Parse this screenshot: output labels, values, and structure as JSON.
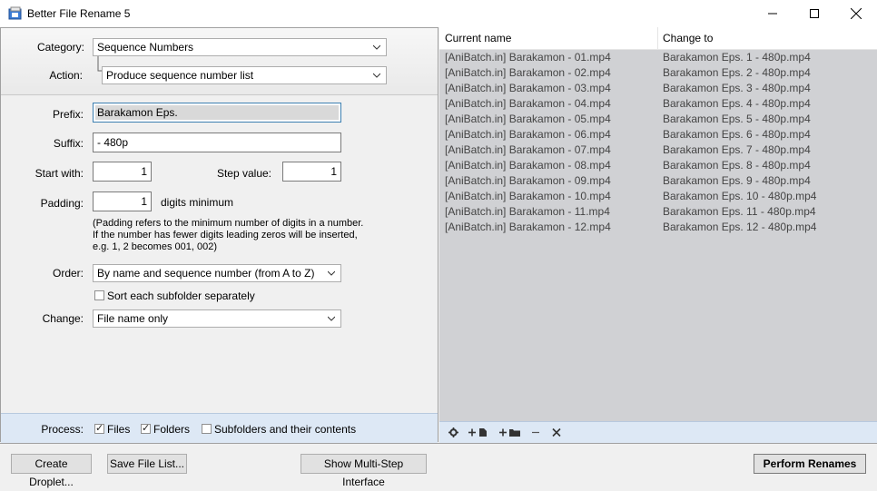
{
  "window": {
    "title": "Better File Rename 5",
    "icon": "app-icon"
  },
  "left_panel": {
    "category_label": "Category:",
    "category_value": "Sequence Numbers",
    "action_label": "Action:",
    "action_value": "Produce sequence number list",
    "prefix_label": "Prefix:",
    "prefix_value": "Barakamon Eps.",
    "suffix_label": "Suffix:",
    "suffix_value": "- 480p",
    "start_label": "Start with:",
    "start_value": "1",
    "step_label": "Step value:",
    "step_value": "1",
    "padding_label": "Padding:",
    "padding_value": "1",
    "padding_suffix": "digits minimum",
    "padding_note_1": "(Padding refers to the minimum number of digits in a number.",
    "padding_note_2": "If the number has fewer digits leading zeros will be inserted,",
    "padding_note_3": "e.g. 1, 2 becomes 001, 002)",
    "order_label": "Order:",
    "order_value": "By name and sequence number (from A to Z)",
    "sort_subfolder_label": "Sort each subfolder separately",
    "sort_subfolder_checked": false,
    "change_label": "Change:",
    "change_value": "File name only",
    "process_label": "Process:",
    "files_label": "Files",
    "files_checked": true,
    "folders_label": "Folders",
    "folders_checked": true,
    "subfolders_label": "Subfolders and their contents",
    "subfolders_checked": false
  },
  "list": {
    "col_current": "Current name",
    "col_change": "Change to",
    "rows": [
      {
        "current": "[AniBatch.in] Barakamon - 01.mp4",
        "change": "Barakamon Eps. 1 - 480p.mp4"
      },
      {
        "current": "[AniBatch.in] Barakamon - 02.mp4",
        "change": "Barakamon Eps. 2 - 480p.mp4"
      },
      {
        "current": "[AniBatch.in] Barakamon - 03.mp4",
        "change": "Barakamon Eps. 3 - 480p.mp4"
      },
      {
        "current": "[AniBatch.in] Barakamon - 04.mp4",
        "change": "Barakamon Eps. 4 - 480p.mp4"
      },
      {
        "current": "[AniBatch.in] Barakamon - 05.mp4",
        "change": "Barakamon Eps. 5 - 480p.mp4"
      },
      {
        "current": "[AniBatch.in] Barakamon - 06.mp4",
        "change": "Barakamon Eps. 6 - 480p.mp4"
      },
      {
        "current": "[AniBatch.in] Barakamon - 07.mp4",
        "change": "Barakamon Eps. 7 - 480p.mp4"
      },
      {
        "current": "[AniBatch.in] Barakamon - 08.mp4",
        "change": "Barakamon Eps. 8 - 480p.mp4"
      },
      {
        "current": "[AniBatch.in] Barakamon - 09.mp4",
        "change": "Barakamon Eps. 9 - 480p.mp4"
      },
      {
        "current": "[AniBatch.in] Barakamon - 10.mp4",
        "change": "Barakamon Eps. 10 - 480p.mp4"
      },
      {
        "current": "[AniBatch.in] Barakamon - 11.mp4",
        "change": "Barakamon Eps. 11 - 480p.mp4"
      },
      {
        "current": "[AniBatch.in] Barakamon - 12.mp4",
        "change": "Barakamon Eps. 12 - 480p.mp4"
      }
    ]
  },
  "list_toolbar": {
    "settings_icon": "gear-icon",
    "add_file_icon": "add-file-icon",
    "add_folder_icon": "add-folder-icon",
    "remove_icon": "minus-icon",
    "clear_icon": "close-icon"
  },
  "buttons": {
    "create_droplet": "Create Droplet...",
    "save_file_list": "Save File List...",
    "show_multistep": "Show Multi-Step Interface",
    "perform_renames": "Perform Renames"
  },
  "colors": {
    "list_background": "#d0d1d4",
    "process_bar": "#dde8f5"
  }
}
